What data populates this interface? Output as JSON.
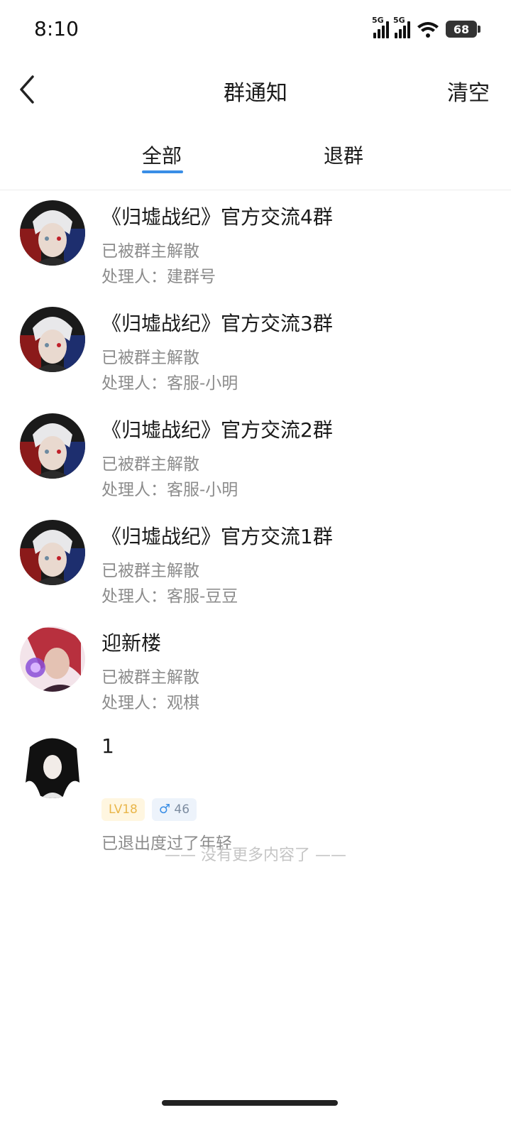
{
  "status": {
    "time": "8:10",
    "network1": "5G",
    "network2": "5G",
    "battery": "68"
  },
  "nav": {
    "title": "群通知",
    "clear_label": "清空"
  },
  "tabs": [
    {
      "label": "全部"
    },
    {
      "label": "退群"
    }
  ],
  "items": [
    {
      "title": "《归墟战纪》官方交流4群",
      "status": "已被群主解散",
      "handler": "处理人：建群号",
      "avatar": "anime-white-hair-avatar"
    },
    {
      "title": "《归墟战纪》官方交流3群",
      "status": "已被群主解散",
      "handler": "处理人：客服-小明",
      "avatar": "anime-white-hair-avatar"
    },
    {
      "title": "《归墟战纪》官方交流2群",
      "status": "已被群主解散",
      "handler": "处理人：客服-小明",
      "avatar": "anime-white-hair-avatar"
    },
    {
      "title": "《归墟战纪》官方交流1群",
      "status": "已被群主解散",
      "handler": "处理人：客服-豆豆",
      "avatar": "anime-white-hair-avatar"
    },
    {
      "title": "迎新楼",
      "status": "已被群主解散",
      "handler": "处理人：观棋",
      "avatar": "anime-red-hair-avatar"
    }
  ],
  "quit_item": {
    "name": "1",
    "level": "LV18",
    "gender_symbol": "♂",
    "age": "46",
    "message": "已退出度过了年轻",
    "avatar": "anime-black-hair-avatar"
  },
  "end_note": "—— 没有更多内容了 ——",
  "colors": {
    "accent": "#3a8ee6",
    "secondary_text": "#8c8c8c",
    "level_badge_bg": "#fff6e0",
    "level_badge_text": "#e9b64a"
  }
}
